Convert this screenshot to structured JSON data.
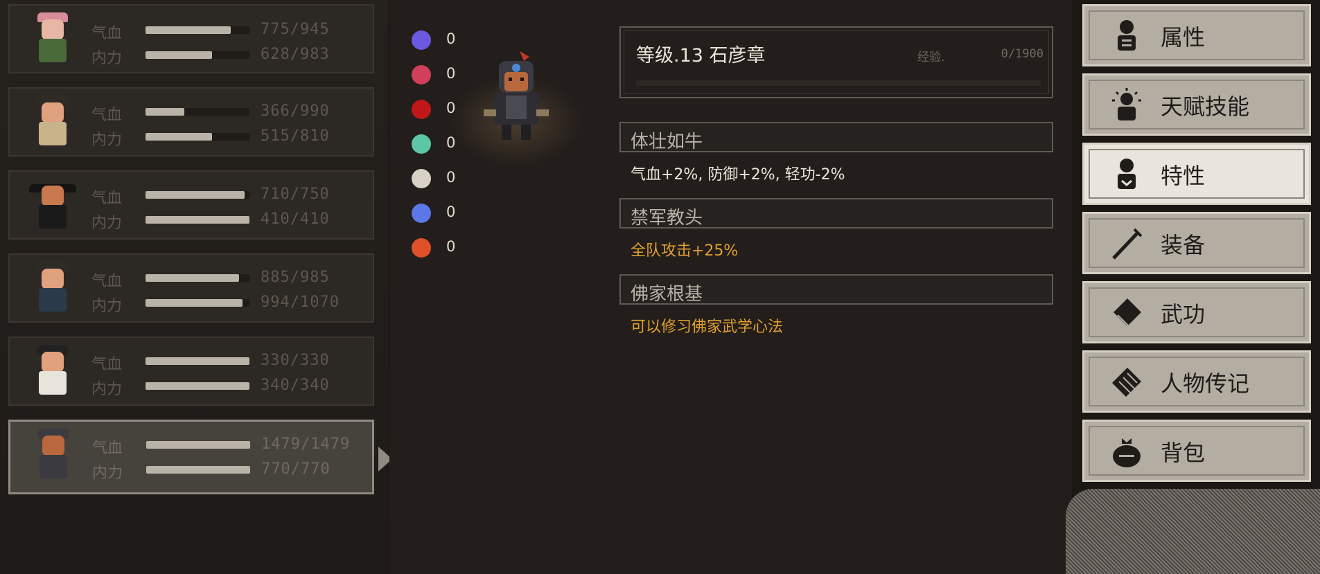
{
  "party": [
    {
      "stats": [
        {
          "label": "气血",
          "value": "775/945",
          "ratio": 0.82
        },
        {
          "label": "内力",
          "value": "628/983",
          "ratio": 0.64
        }
      ],
      "head": "#e7b6a4",
      "hat": "#d98c9a"
    },
    {
      "stats": [
        {
          "label": "气血",
          "value": "366/990",
          "ratio": 0.37
        },
        {
          "label": "内力",
          "value": "515/810",
          "ratio": 0.64
        }
      ],
      "head": "#e0a27e",
      "hat": "#2e2a26"
    },
    {
      "stats": [
        {
          "label": "气血",
          "value": "710/750",
          "ratio": 0.95
        },
        {
          "label": "内力",
          "value": "410/410",
          "ratio": 1.0
        }
      ],
      "head": "#c9794e",
      "hat": "#141414"
    },
    {
      "stats": [
        {
          "label": "气血",
          "value": "885/985",
          "ratio": 0.9
        },
        {
          "label": "内力",
          "value": "994/1070",
          "ratio": 0.93
        }
      ],
      "head": "#e0a27e",
      "hat": "#2e2a26"
    },
    {
      "stats": [
        {
          "label": "气血",
          "value": "330/330",
          "ratio": 1.0
        },
        {
          "label": "内力",
          "value": "340/340",
          "ratio": 1.0
        }
      ],
      "head": "#e0a27e",
      "hat": "#222"
    },
    {
      "stats": [
        {
          "label": "气血",
          "value": "1479/1479",
          "ratio": 1.0
        },
        {
          "label": "内力",
          "value": "770/770",
          "ratio": 1.0
        }
      ],
      "head": "#b8683c",
      "hat": "#3a3a40"
    }
  ],
  "resources": [
    {
      "icon": "skull-icon",
      "color": "#6a5ae0",
      "value": "0"
    },
    {
      "icon": "broken-heart-icon",
      "color": "#d0405a",
      "value": "0"
    },
    {
      "icon": "spiky-blood-icon",
      "color": "#c01818",
      "value": "0"
    },
    {
      "icon": "green-virus-icon",
      "color": "#5ac8a8",
      "value": "0"
    },
    {
      "icon": "bone-icon",
      "color": "#d8d2c6",
      "value": "0"
    },
    {
      "icon": "blue-spiral-icon",
      "color": "#5a78e8",
      "value": "0"
    },
    {
      "icon": "fire-icon",
      "color": "#e0502a",
      "value": "0"
    }
  ],
  "character": {
    "level_name": "等级.13  石彦章",
    "exp_label": "经验.",
    "exp_value": "0/1900",
    "exp_ratio": 0.0
  },
  "traits": [
    {
      "title": "体壮如牛",
      "desc": "气血+2%, 防御+2%, 轻功-2%",
      "desc_color": "#ece6da"
    },
    {
      "title": "禁军教头",
      "desc": "全队攻击+25%",
      "desc_color": "#e0a030"
    },
    {
      "title": "佛家根基",
      "desc": "可以修习佛家武学心法",
      "desc_color": "#e0a030"
    }
  ],
  "menu": [
    {
      "label": "属性",
      "icon": "person-icon",
      "active": false
    },
    {
      "label": "天赋技能",
      "icon": "radiant-person-icon",
      "active": false
    },
    {
      "label": "特性",
      "icon": "traits-person-icon",
      "active": true
    },
    {
      "label": "装备",
      "icon": "sword-icon",
      "active": false
    },
    {
      "label": "武功",
      "icon": "book-icon",
      "active": false
    },
    {
      "label": "人物传记",
      "icon": "scroll-icon",
      "active": false
    },
    {
      "label": "背包",
      "icon": "bag-icon",
      "active": false
    }
  ]
}
